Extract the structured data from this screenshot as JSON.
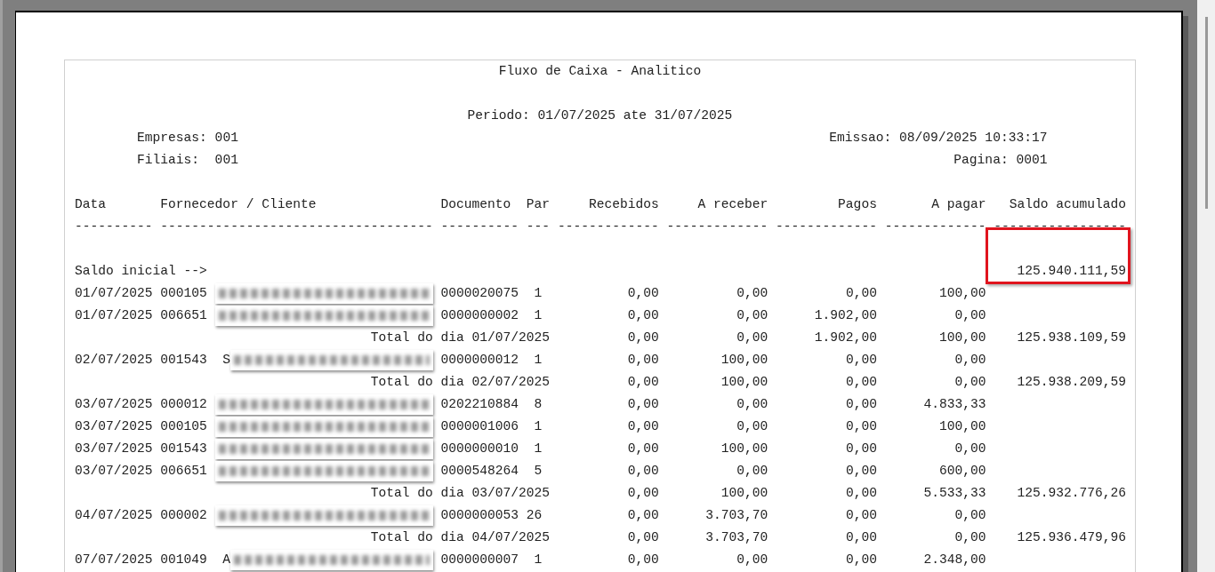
{
  "report": {
    "title": "Fluxo de Caixa - Analitico",
    "period": "Periodo: 01/07/2025 ate 31/07/2025",
    "companies": "Empresas: 001",
    "issued": "Emissao: 08/09/2025 10:33:17",
    "branches": "Filiais:  001",
    "page": "Pagina: 0001"
  },
  "columns": [
    "Data",
    "Fornecedor / Cliente",
    "Documento",
    "Par",
    "Recebidos",
    "A receber",
    "Pagos",
    "A pagar",
    "Saldo acumulado"
  ],
  "separators": [
    "----------",
    "-----------------------------------",
    "----------",
    "---",
    "-------------",
    "-------------",
    "-------------",
    "-------------",
    "-----------------"
  ],
  "opening": {
    "label": "Saldo inicial -->",
    "balance": "125.940.111,59",
    "highlighted": true
  },
  "rows": [
    {
      "kind": "entry",
      "date": "01/07/2025",
      "code": "000105",
      "document": "0000020075",
      "par": "1",
      "received": "0,00",
      "receivable": "0,00",
      "paid": "0,00",
      "payable": "100,00"
    },
    {
      "kind": "entry",
      "date": "01/07/2025",
      "code": "006651",
      "document": "0000000002",
      "par": "1",
      "received": "0,00",
      "receivable": "0,00",
      "paid": "1.902,00",
      "payable": "0,00"
    },
    {
      "kind": "total",
      "label": "Total do dia 01/07/2025",
      "received": "0,00",
      "receivable": "0,00",
      "paid": "1.902,00",
      "payable": "100,00",
      "balance": "125.938.109,59"
    },
    {
      "kind": "entry",
      "date": "02/07/2025",
      "code": "001543",
      "name_start": "S",
      "document": "0000000012",
      "par": "1",
      "received": "0,00",
      "receivable": "100,00",
      "paid": "0,00",
      "payable": "0,00"
    },
    {
      "kind": "total",
      "label": "Total do dia 02/07/2025",
      "received": "0,00",
      "receivable": "100,00",
      "paid": "0,00",
      "payable": "0,00",
      "balance": "125.938.209,59"
    },
    {
      "kind": "entry",
      "date": "03/07/2025",
      "code": "000012",
      "document": "0202210884",
      "par": "8",
      "received": "0,00",
      "receivable": "0,00",
      "paid": "0,00",
      "payable": "4.833,33"
    },
    {
      "kind": "entry",
      "date": "03/07/2025",
      "code": "000105",
      "document": "0000001006",
      "par": "1",
      "received": "0,00",
      "receivable": "0,00",
      "paid": "0,00",
      "payable": "100,00"
    },
    {
      "kind": "entry",
      "date": "03/07/2025",
      "code": "001543",
      "document": "0000000010",
      "par": "1",
      "received": "0,00",
      "receivable": "100,00",
      "paid": "0,00",
      "payable": "0,00"
    },
    {
      "kind": "entry",
      "date": "03/07/2025",
      "code": "006651",
      "document": "0000548264",
      "par": "5",
      "received": "0,00",
      "receivable": "0,00",
      "paid": "0,00",
      "payable": "600,00"
    },
    {
      "kind": "total",
      "label": "Total do dia 03/07/2025",
      "received": "0,00",
      "receivable": "100,00",
      "paid": "0,00",
      "payable": "5.533,33",
      "balance": "125.932.776,26"
    },
    {
      "kind": "entry",
      "date": "04/07/2025",
      "code": "000002",
      "document": "0000000053",
      "par": "26",
      "received": "0,00",
      "receivable": "3.703,70",
      "paid": "0,00",
      "payable": "0,00"
    },
    {
      "kind": "total",
      "label": "Total do dia 04/07/2025",
      "received": "0,00",
      "receivable": "3.703,70",
      "paid": "0,00",
      "payable": "0,00",
      "balance": "125.936.479,96"
    },
    {
      "kind": "entry",
      "date": "07/07/2025",
      "code": "001049",
      "name_start": "A",
      "document": "0000000007",
      "par": "1",
      "received": "0,00",
      "receivable": "0,00",
      "paid": "0,00",
      "payable": "2.348,00"
    }
  ]
}
